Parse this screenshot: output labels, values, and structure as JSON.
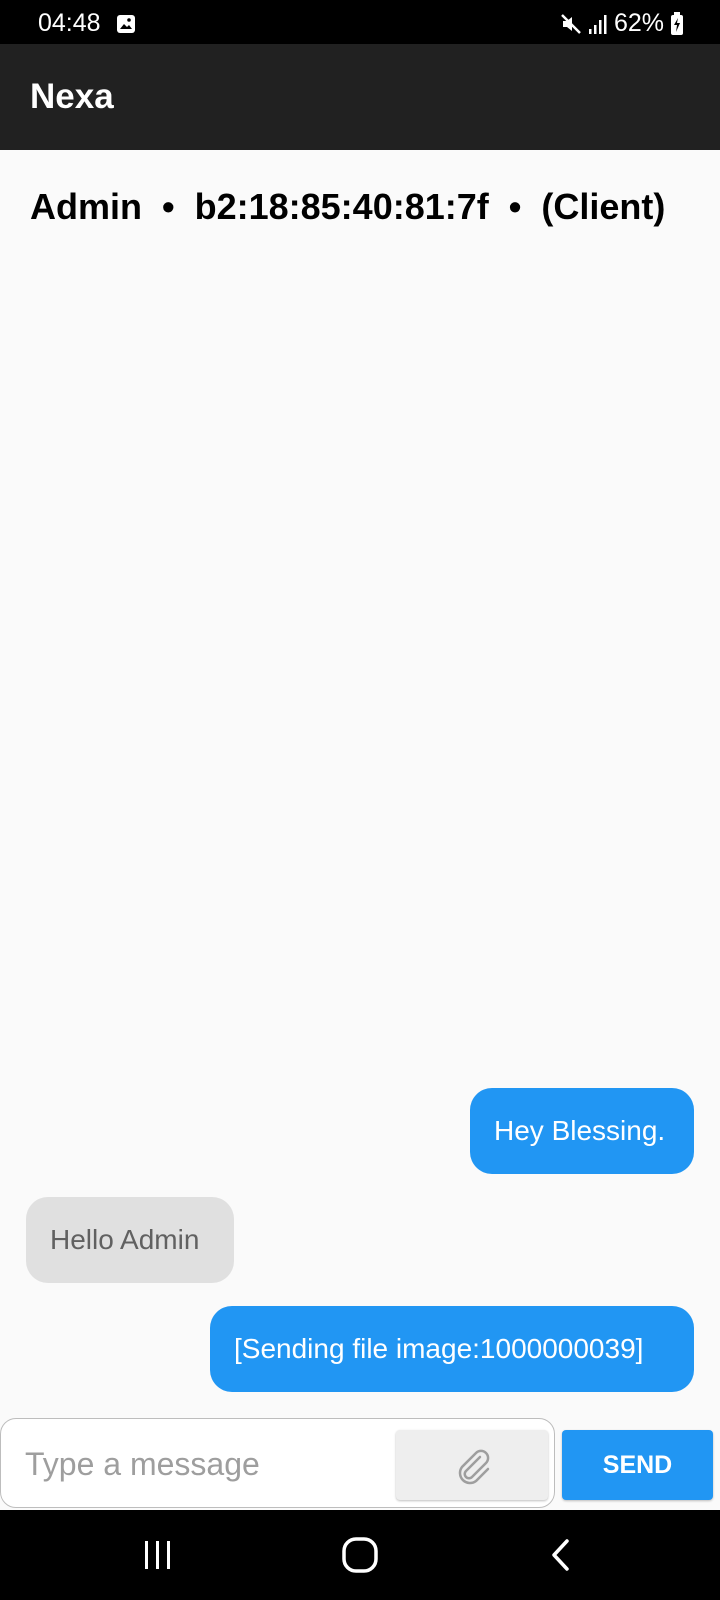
{
  "status_bar": {
    "time": "04:48",
    "battery": "62%",
    "icons": [
      "gallery-icon",
      "mute-icon",
      "signal-icon",
      "battery-charging-icon"
    ]
  },
  "app_bar": {
    "title": "Nexa"
  },
  "chat_header": {
    "name": "Admin",
    "separator": "•",
    "address": "b2:18:85:40:81:7f",
    "role": "(Client)"
  },
  "messages": [
    {
      "direction": "out",
      "text": "Hey Blessing."
    },
    {
      "direction": "in",
      "text": "Hello Admin"
    },
    {
      "direction": "out",
      "text": "[Sending file image:1000000039]"
    }
  ],
  "composer": {
    "placeholder": "Type a message",
    "value": "",
    "attach_icon": "paperclip-icon",
    "send_label": "SEND"
  },
  "nav": {
    "icons": [
      "recent-apps-icon",
      "home-icon",
      "back-icon"
    ]
  },
  "colors": {
    "accent": "#2196f3",
    "app_bar": "#212121",
    "incoming_bubble": "#e0e0e0",
    "background": "#fafafa"
  }
}
